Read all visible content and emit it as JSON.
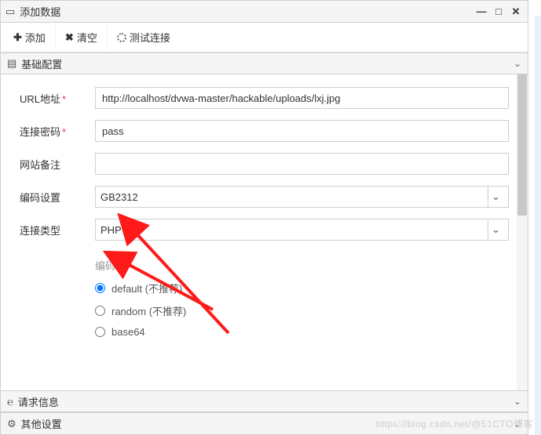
{
  "window": {
    "title": "添加数据"
  },
  "toolbar": {
    "add_label": "添加",
    "clear_label": "清空",
    "test_label": "测试连接"
  },
  "panels": {
    "basic": {
      "title": "基础配置"
    },
    "request": {
      "title": "请求信息"
    },
    "other": {
      "title": "其他设置"
    }
  },
  "form": {
    "url": {
      "label": "URL地址",
      "value": "http://localhost/dvwa-master/hackable/uploads/lxj.jpg",
      "required": true
    },
    "password": {
      "label": "连接密码",
      "value": "pass",
      "required": true
    },
    "remark": {
      "label": "网站备注",
      "value": ""
    },
    "encoding": {
      "label": "编码设置",
      "value": "GB2312"
    },
    "conn_type": {
      "label": "连接类型",
      "value": "PHP"
    },
    "encoder": {
      "label": "编码器",
      "options": [
        {
          "value": "default",
          "label": "default (不推荐)",
          "checked": true
        },
        {
          "value": "random",
          "label": "random (不推荐)",
          "checked": false
        },
        {
          "value": "base64",
          "label": "base64",
          "checked": false
        }
      ]
    }
  },
  "watermark": "https://blog.csdn.net/@51CTO博客"
}
